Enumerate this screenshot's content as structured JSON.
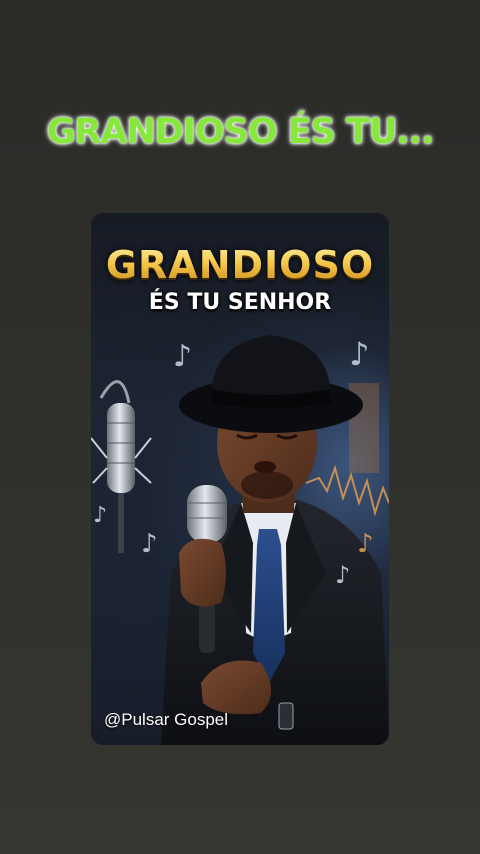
{
  "headline": {
    "text": "GRANDIOSO ÉS TU..."
  },
  "thumbnail": {
    "title": "GRANDIOSO",
    "subtitle": "ÉS TU SENHOR",
    "watermark": "@Pulsar Gospel",
    "music_note_glyph": "♪",
    "colors": {
      "title_gold": "#f4c542",
      "headline_green": "#86e83a",
      "subtitle_white": "#ffffff"
    }
  }
}
